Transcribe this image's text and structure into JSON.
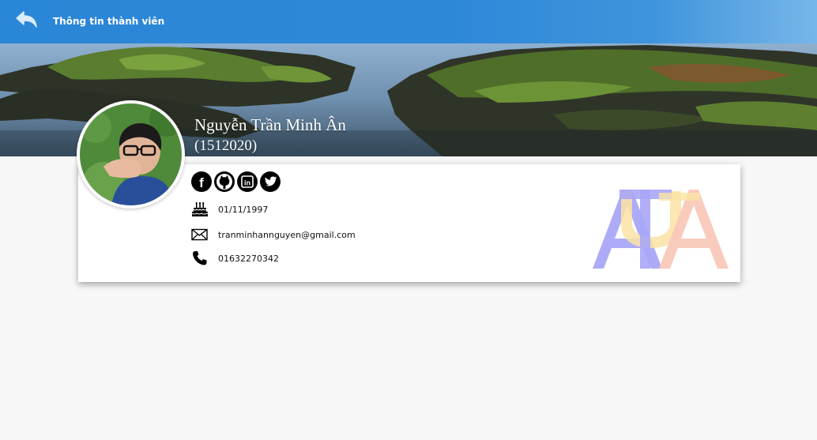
{
  "header": {
    "title": "Thông tin thành viên",
    "back_icon": "back-arrow-icon",
    "gradient": [
      "#2a86d6",
      "#76b6e8"
    ]
  },
  "profile": {
    "name": "Nguyễn Trần Minh Ân",
    "student_id": "(1512020)",
    "socials": [
      {
        "icon": "facebook-icon",
        "label": "f"
      },
      {
        "icon": "github-icon"
      },
      {
        "icon": "linkedin-icon",
        "label": "in"
      },
      {
        "icon": "twitter-icon"
      }
    ],
    "birthday": "01/11/1997",
    "email": "tranminhannguyen@gmail.com",
    "phone": "01632270342"
  },
  "logo": {
    "letters": [
      "A",
      "T",
      "A",
      "U"
    ],
    "colors": [
      "#a9a6f7",
      "#fbe3a4",
      "#f9c8b9"
    ]
  }
}
